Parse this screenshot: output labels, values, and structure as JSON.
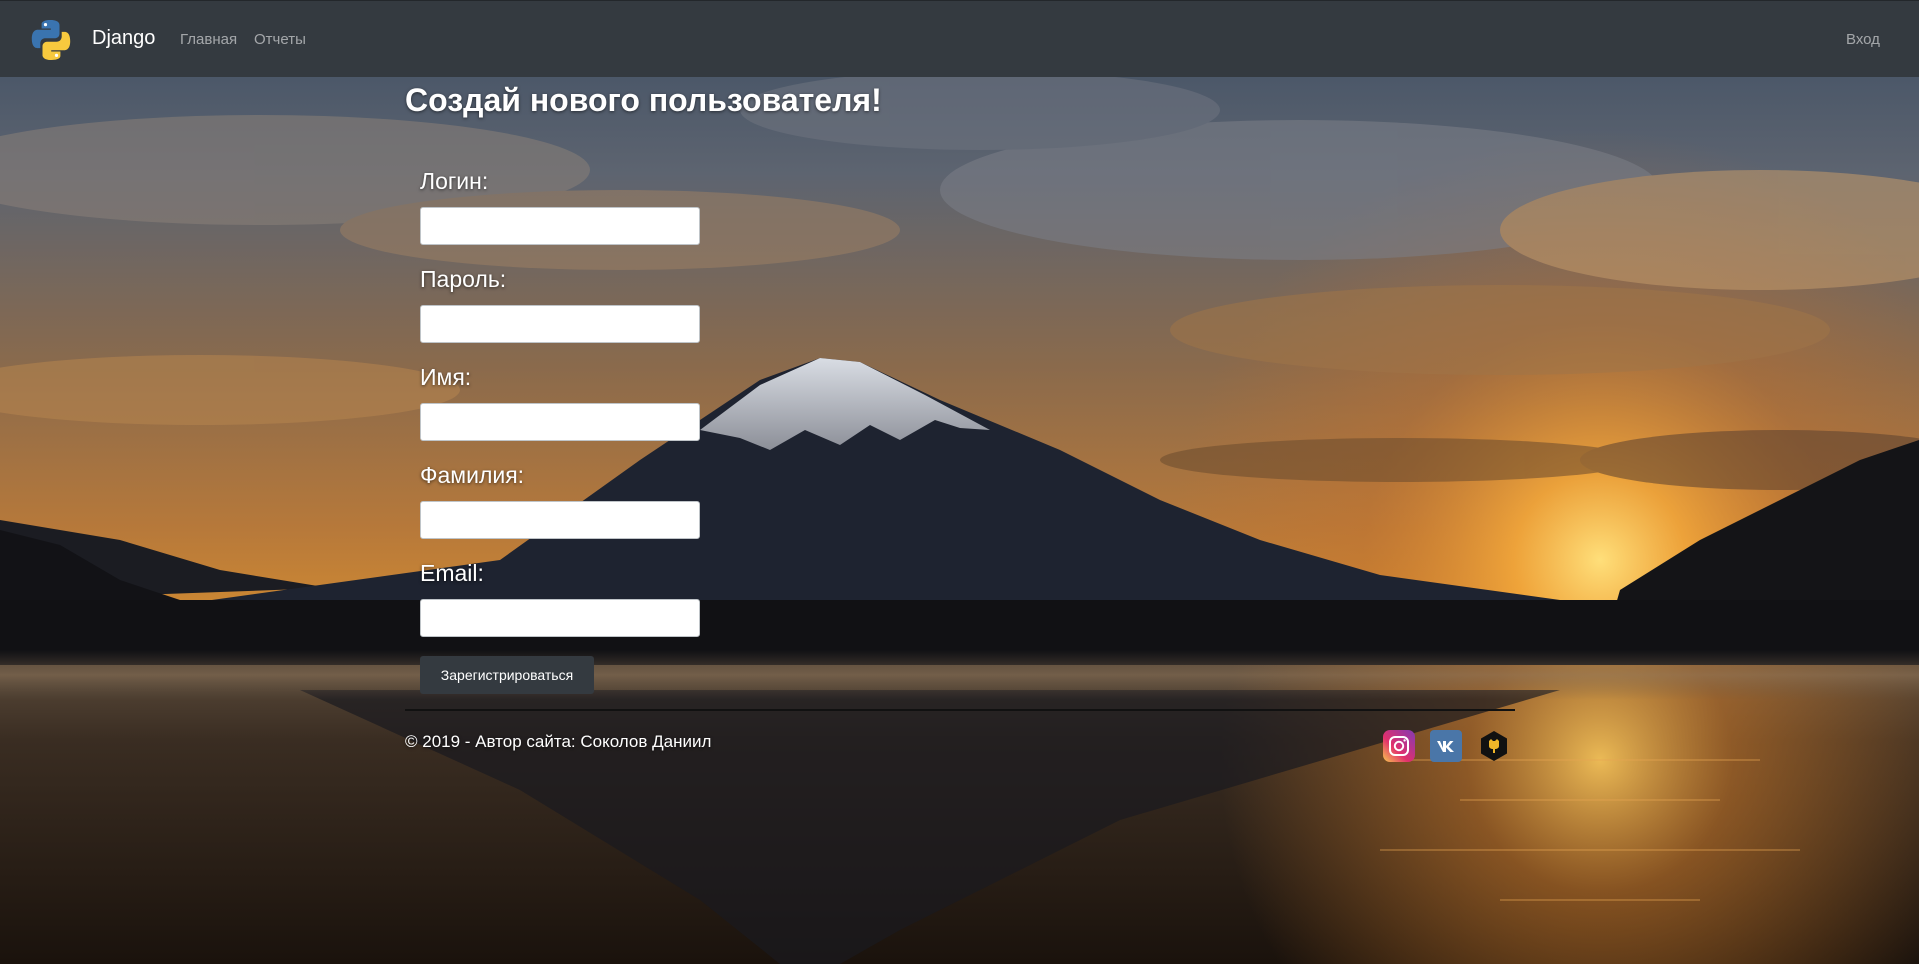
{
  "navbar": {
    "brand": "Django",
    "links": [
      {
        "label": "Главная"
      },
      {
        "label": "Отчеты"
      }
    ],
    "login_label": "Вход"
  },
  "form": {
    "title": "Создай нового пользователя!",
    "fields": [
      {
        "label": "Логин:",
        "value": ""
      },
      {
        "label": "Пароль:",
        "value": ""
      },
      {
        "label": "Имя:",
        "value": ""
      },
      {
        "label": "Фамилия:",
        "value": ""
      },
      {
        "label": "Email:",
        "value": ""
      }
    ],
    "submit_label": "Зарегистрироваться"
  },
  "footer": {
    "copyright": "© 2019 - Автор сайта: Соколов Даниил",
    "social": [
      {
        "icon": "instagram-icon"
      },
      {
        "icon": "vk-icon"
      },
      {
        "icon": "github-icon"
      }
    ]
  },
  "colors": {
    "navbar_bg": "#343a40",
    "button_bg": "#343a40",
    "text_light": "#ffffff",
    "nav_link": "#a0a4a8"
  }
}
